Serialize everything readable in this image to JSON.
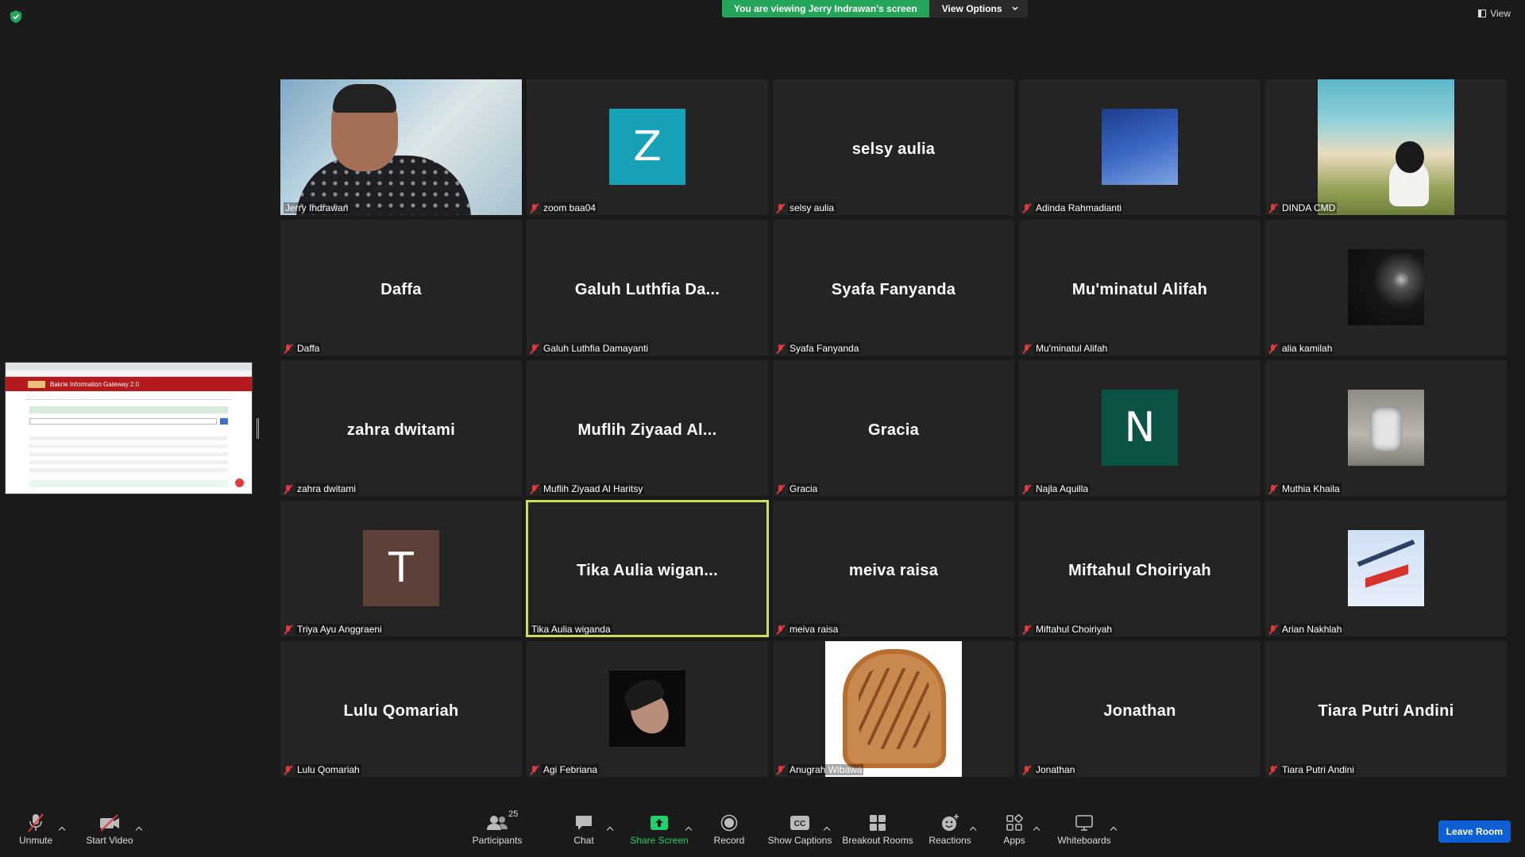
{
  "top": {
    "viewing_banner": "You are viewing Jerry Indrawan's screen",
    "view_options": "View Options",
    "view_button": "View"
  },
  "shared_screen": {
    "app_title": "Bakrie Information Gateway 2.0"
  },
  "tiles": [
    {
      "name": "Jerry Indrawan",
      "display": "",
      "type": "video",
      "muted": false
    },
    {
      "name": "zoom baa04",
      "display": "",
      "type": "letter",
      "letter": "Z",
      "color": "#17a2b8",
      "muted": true
    },
    {
      "name": "selsy aulia",
      "display": "selsy aulia",
      "type": "name",
      "muted": true
    },
    {
      "name": "Adinda Rahmadianti",
      "display": "",
      "type": "pic",
      "pic": "sky",
      "muted": true
    },
    {
      "name": "DINDA CMD",
      "display": "",
      "type": "pic-tall",
      "pic": "beach",
      "muted": true
    },
    {
      "name": "Daffa",
      "display": "Daffa",
      "type": "name",
      "muted": true
    },
    {
      "name": "Galuh Luthfia Damayanti",
      "display": "Galuh  Luthfia  Da...",
      "type": "name",
      "muted": true
    },
    {
      "name": "Syafa Fanyanda",
      "display": "Syafa Fanyanda",
      "type": "name",
      "muted": true
    },
    {
      "name": "Mu'minatul Alifah",
      "display": "Mu'minatul Alifah",
      "type": "name",
      "muted": true
    },
    {
      "name": "alia kamilah",
      "display": "",
      "type": "pic",
      "pic": "dark-portrait",
      "muted": true
    },
    {
      "name": "zahra dwitami",
      "display": "zahra dwitami",
      "type": "name",
      "muted": true
    },
    {
      "name": "Muflih Ziyaad Al Haritsy",
      "display": "Muflih  Ziyaad  Al...",
      "type": "name",
      "muted": true
    },
    {
      "name": "Gracia",
      "display": "Gracia",
      "type": "name",
      "muted": true
    },
    {
      "name": "Najla Aquilla",
      "display": "",
      "type": "letter",
      "letter": "N",
      "color": "#0b5345",
      "muted": true
    },
    {
      "name": "Muthia Khaila",
      "display": "",
      "type": "pic",
      "pic": "robot",
      "muted": true
    },
    {
      "name": "Triya Ayu Anggraeni",
      "display": "",
      "type": "letter",
      "letter": "T",
      "color": "#5d4037",
      "muted": true
    },
    {
      "name": "Tika Aulia wiganda",
      "display": "Tika  Aulia  wigan...",
      "type": "name",
      "muted": false,
      "active": true
    },
    {
      "name": "meiva raisa",
      "display": "meiva raisa",
      "type": "name",
      "muted": true
    },
    {
      "name": "Miftahul Choiriyah",
      "display": "Miftahul Choiriyah",
      "type": "name",
      "muted": true
    },
    {
      "name": "Arian Nakhlah",
      "display": "",
      "type": "pic",
      "pic": "gym",
      "muted": true
    },
    {
      "name": "Lulu Qomariah",
      "display": "Lulu Qomariah",
      "type": "name",
      "muted": true
    },
    {
      "name": "Agi Febriana",
      "display": "",
      "type": "pic",
      "pic": "car",
      "muted": true
    },
    {
      "name": "Anugrah Wibawa",
      "display": "",
      "type": "pic-tall",
      "pic": "toast",
      "muted": true
    },
    {
      "name": "Jonathan",
      "display": "Jonathan",
      "type": "name",
      "muted": true
    },
    {
      "name": "Tiara Putri Andini",
      "display": "Tiara Putri Andini",
      "type": "name",
      "muted": true
    }
  ],
  "toolbar": {
    "unmute": "Unmute",
    "start_video": "Start Video",
    "participants": "Participants",
    "participants_count": "25",
    "chat": "Chat",
    "share_screen": "Share Screen",
    "record": "Record",
    "show_captions": "Show Captions",
    "breakout_rooms": "Breakout Rooms",
    "reactions": "Reactions",
    "apps": "Apps",
    "whiteboards": "Whiteboards",
    "leave_room": "Leave Room"
  },
  "colors": {
    "banner_green": "#23a65a",
    "active_speaker": "#cddc5a",
    "leave_blue": "#0e5ed6",
    "muted_red": "#e0393e"
  }
}
